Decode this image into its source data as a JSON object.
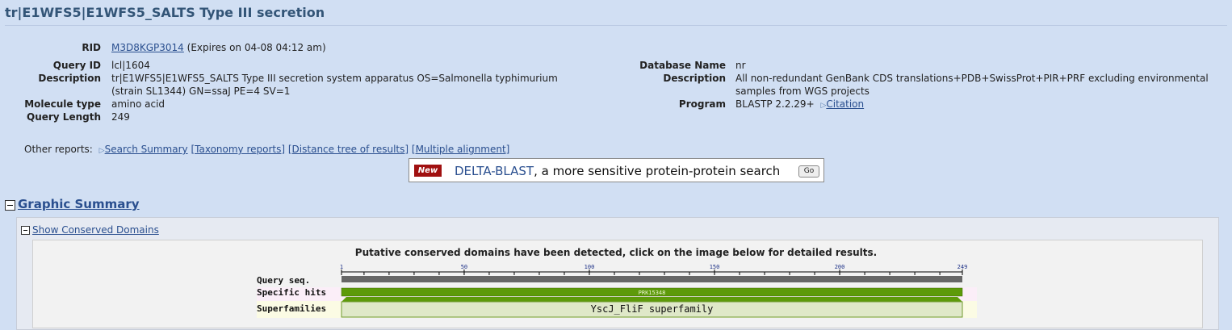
{
  "title": "tr|E1WFS5|E1WFS5_SALTS Type III secretion",
  "left_info": {
    "rid_label": "RID",
    "rid_value": "M3D8KGP3014",
    "rid_expires": "(Expires on 04-08 04:12 am)",
    "query_id_label": "Query ID",
    "query_id_value": "lcl|1604",
    "description_label": "Description",
    "description_line1": "tr|E1WFS5|E1WFS5_SALTS Type III secretion system apparatus OS=Salmonella typhimurium",
    "description_line2": "(strain SL1344) GN=ssaJ PE=4 SV=1",
    "molecule_label": "Molecule type",
    "molecule_value": "amino acid",
    "length_label": "Query Length",
    "length_value": "249"
  },
  "right_info": {
    "db_label": "Database Name",
    "db_value": "nr",
    "description_label": "Description",
    "description_line1": "All non-redundant GenBank CDS translations+PDB+SwissProt+PIR+PRF excluding environmental",
    "description_line2": "samples from WGS projects",
    "program_label": "Program",
    "program_value": "BLASTP 2.2.29+",
    "citation": "Citation"
  },
  "other_reports": {
    "label": "Other reports:",
    "links": [
      "Search Summary",
      "[Taxonomy reports]",
      "[Distance tree of results]",
      "[Multiple alignment]"
    ]
  },
  "delta_blast": {
    "badge": "New",
    "link": "DELTA-BLAST",
    "text": ", a more sensitive protein-protein search",
    "go": "Go"
  },
  "graphic_summary": {
    "title": "Graphic Summary",
    "show_cd": "Show Conserved Domains",
    "message": "Putative conserved domains have been detected, click on the image below for detailed results."
  },
  "cd_graphic": {
    "row_labels": [
      "Query seq.",
      "Specific hits",
      "Superfamilies"
    ],
    "query_length": 249,
    "ticks": [
      1,
      50,
      100,
      150,
      200,
      249
    ],
    "specific_hit": {
      "name": "PRK15348",
      "start": 1,
      "end": 249
    },
    "superfamily": {
      "name": "YscJ_FliF superfamily",
      "start": 1,
      "end": 249
    },
    "colors": {
      "query": "#666666",
      "hit": "#5d9a0a",
      "superfamily": "#dfe8c8",
      "hit_row_bg": "#fbeef8",
      "sf_row_bg": "#fbfbe4"
    }
  }
}
